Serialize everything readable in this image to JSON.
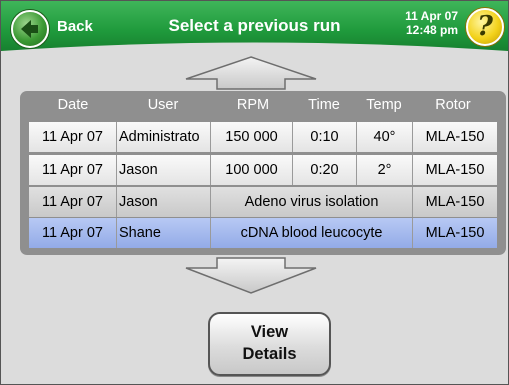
{
  "header": {
    "back_label": "Back",
    "title": "Select a previous run",
    "date": "11 Apr 07",
    "time": "12:48 pm",
    "help_symbol": "?",
    "colors": {
      "bar": "#1f9a3c",
      "back_button": "#3c9a35",
      "help_button": "#f3d21b"
    }
  },
  "table": {
    "columns": [
      "Date",
      "User",
      "RPM",
      "Time",
      "Temp",
      "Rotor"
    ],
    "rows": [
      {
        "date": "11 Apr 07",
        "user": "Administrato",
        "rpm": "150 000",
        "time": "0:10",
        "temp": "40°",
        "rotor": "MLA-150"
      },
      {
        "date": "11 Apr 07",
        "user": "Jason",
        "rpm": "100 000",
        "time": "0:20",
        "temp": "2°",
        "rotor": "MLA-150"
      },
      {
        "date": "11 Apr 07",
        "user": "Jason",
        "description": "Adeno virus isolation",
        "rotor": "MLA-150"
      },
      {
        "date": "11 Apr 07",
        "user": "Shane",
        "description": "cDNA blood leucocyte",
        "rotor": "MLA-150",
        "selected": true
      }
    ],
    "colors": {
      "selected_row": "#a3b8ee",
      "panel": "#8f8f8f"
    }
  },
  "icons": {
    "scroll_up": "up-arrow-icon",
    "scroll_down": "down-arrow-icon",
    "back": "left-arrow-icon",
    "help": "question-mark-icon"
  },
  "buttons": {
    "view_details_line1": "View",
    "view_details_line2": "Details"
  }
}
